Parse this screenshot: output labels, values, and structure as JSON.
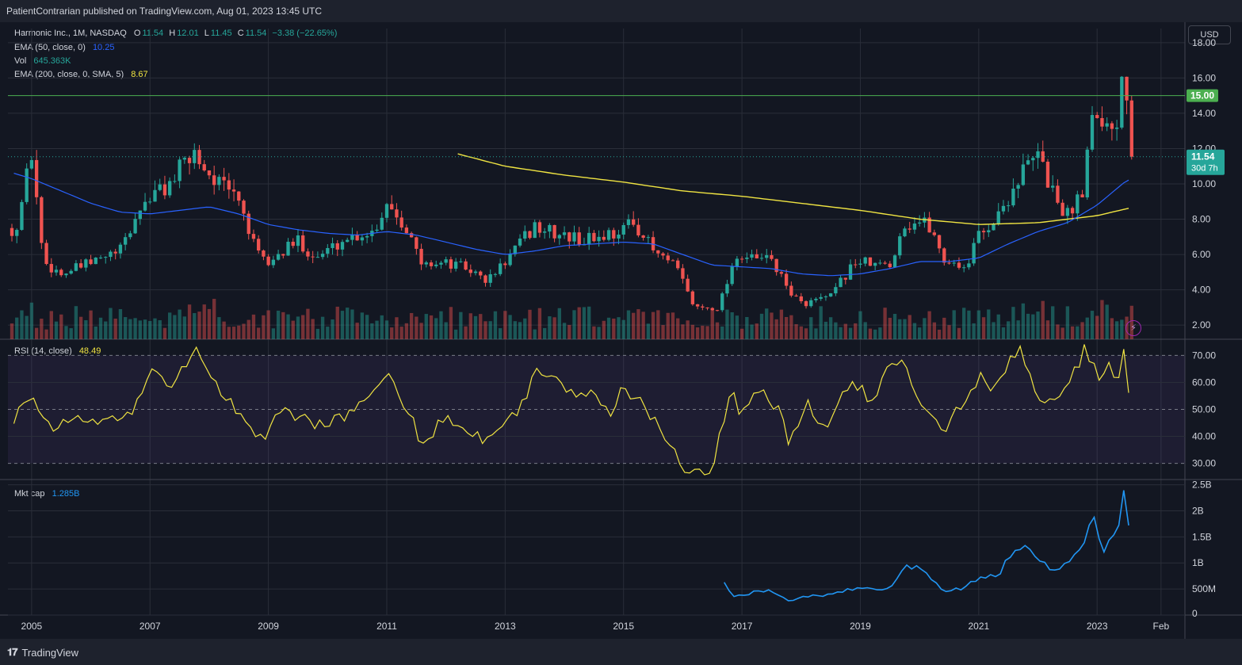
{
  "header": {
    "publisher": "PatientContrarian published on TradingView.com, Aug 01, 2023 13:45 UTC"
  },
  "footer": {
    "brand": "TradingView"
  },
  "currency_button": "USD",
  "legends": {
    "symbol": "Harmonic Inc., 1M, NASDAQ",
    "o_label": "O",
    "o_value": "11.54",
    "h_label": "H",
    "h_value": "12.01",
    "l_label": "L",
    "l_value": "11.45",
    "c_label": "C",
    "c_value": "11.54",
    "change": "−3.38 (−22.65%)",
    "ema50_label": "EMA (50, close, 0)",
    "ema50_value": "10.25",
    "vol_label": "Vol",
    "vol_value": "645.363K",
    "ema200_label": "EMA (200, close, 0, SMA, 5)",
    "ema200_value": "8.67",
    "rsi_label": "RSI (14, close)",
    "rsi_value": "48.49",
    "mktcap_label": "Mkt cap",
    "mktcap_value": "1.285B"
  },
  "price_tags": {
    "level": "15.00",
    "last": "11.54",
    "countdown": "30d 7h"
  },
  "colors": {
    "up": "#26a69a",
    "down": "#ef5350",
    "ema50": "#2962ff",
    "ema200": "#f0e442",
    "rsi": "#f0e442",
    "mktcap": "#2196f3",
    "level": "#4caf50",
    "background": "#131722"
  },
  "chart_data": {
    "type": "candlestick",
    "interval": "1M",
    "symbol": "Harmonic Inc., NASDAQ",
    "x_ticks": [
      "2005",
      "2007",
      "2009",
      "2011",
      "2013",
      "2015",
      "2017",
      "2019",
      "2021",
      "2023",
      "Feb"
    ],
    "price_axis": {
      "ticks": [
        "18.00",
        "16.00",
        "14.00",
        "12.00",
        "10.00",
        "8.00",
        "6.00",
        "4.00",
        "2.00"
      ],
      "range": [
        1.2,
        18.8
      ]
    },
    "horizontal_level": 15.0,
    "last_price": 11.54,
    "close_anchors": [
      [
        2004.75,
        7.5
      ],
      [
        2005.0,
        11.8
      ],
      [
        2005.2,
        5.6
      ],
      [
        2005.5,
        4.9
      ],
      [
        2006.0,
        5.5
      ],
      [
        2006.5,
        6.2
      ],
      [
        2006.9,
        9.0
      ],
      [
        2007.3,
        9.9
      ],
      [
        2007.75,
        11.8
      ],
      [
        2008.0,
        10.6
      ],
      [
        2008.3,
        9.6
      ],
      [
        2008.5,
        9.2
      ],
      [
        2008.8,
        6.0
      ],
      [
        2009.0,
        5.5
      ],
      [
        2009.5,
        6.8
      ],
      [
        2009.8,
        5.8
      ],
      [
        2010.3,
        6.9
      ],
      [
        2010.8,
        7.4
      ],
      [
        2011.0,
        9.0
      ],
      [
        2011.3,
        7.8
      ],
      [
        2011.6,
        5.3
      ],
      [
        2011.8,
        5.6
      ],
      [
        2012.3,
        5.3
      ],
      [
        2012.7,
        4.5
      ],
      [
        2013.0,
        5.6
      ],
      [
        2013.5,
        7.6
      ],
      [
        2013.8,
        7.2
      ],
      [
        2014.3,
        6.8
      ],
      [
        2014.8,
        7.2
      ],
      [
        2015.2,
        7.8
      ],
      [
        2015.5,
        6.2
      ],
      [
        2015.9,
        5.2
      ],
      [
        2016.2,
        3.0
      ],
      [
        2016.6,
        3.0
      ],
      [
        2016.9,
        6.0
      ],
      [
        2017.2,
        5.7
      ],
      [
        2017.5,
        5.8
      ],
      [
        2017.7,
        4.4
      ],
      [
        2018.0,
        3.2
      ],
      [
        2018.5,
        3.6
      ],
      [
        2018.9,
        5.6
      ],
      [
        2019.5,
        5.3
      ],
      [
        2019.7,
        7.6
      ],
      [
        2020.0,
        7.9
      ],
      [
        2020.2,
        7.5
      ],
      [
        2020.4,
        5.7
      ],
      [
        2020.8,
        5.3
      ],
      [
        2021.0,
        7.2
      ],
      [
        2021.3,
        8.0
      ],
      [
        2021.7,
        10.5
      ],
      [
        2022.0,
        11.6
      ],
      [
        2022.3,
        9.2
      ],
      [
        2022.5,
        8.2
      ],
      [
        2022.75,
        9.8
      ],
      [
        2022.9,
        13.8
      ],
      [
        2023.0,
        14.5
      ],
      [
        2023.2,
        12.9
      ],
      [
        2023.35,
        14.0
      ],
      [
        2023.45,
        17.5
      ],
      [
        2023.58,
        11.54
      ]
    ],
    "ema50_anchors": [
      [
        2004.7,
        10.6
      ],
      [
        2005.0,
        10.3
      ],
      [
        2005.5,
        9.6
      ],
      [
        2006.0,
        8.9
      ],
      [
        2006.5,
        8.4
      ],
      [
        2007.0,
        8.3
      ],
      [
        2007.5,
        8.5
      ],
      [
        2008.0,
        8.7
      ],
      [
        2008.5,
        8.3
      ],
      [
        2009.0,
        7.7
      ],
      [
        2009.5,
        7.4
      ],
      [
        2010.0,
        7.2
      ],
      [
        2010.5,
        7.1
      ],
      [
        2011.0,
        7.3
      ],
      [
        2011.5,
        7.1
      ],
      [
        2012.0,
        6.7
      ],
      [
        2012.5,
        6.3
      ],
      [
        2013.0,
        6.0
      ],
      [
        2013.5,
        6.2
      ],
      [
        2014.0,
        6.5
      ],
      [
        2014.5,
        6.6
      ],
      [
        2015.0,
        6.7
      ],
      [
        2015.5,
        6.6
      ],
      [
        2016.0,
        6.0
      ],
      [
        2016.5,
        5.4
      ],
      [
        2017.0,
        5.3
      ],
      [
        2017.5,
        5.2
      ],
      [
        2018.0,
        4.9
      ],
      [
        2018.5,
        4.8
      ],
      [
        2019.0,
        4.9
      ],
      [
        2019.5,
        5.2
      ],
      [
        2020.0,
        5.6
      ],
      [
        2020.5,
        5.6
      ],
      [
        2021.0,
        5.8
      ],
      [
        2021.5,
        6.6
      ],
      [
        2022.0,
        7.3
      ],
      [
        2022.5,
        7.8
      ],
      [
        2023.0,
        8.8
      ],
      [
        2023.5,
        10.2
      ],
      [
        2023.6,
        10.25
      ]
    ],
    "ema200_anchors": [
      [
        2012.2,
        11.7
      ],
      [
        2013.0,
        11.0
      ],
      [
        2014.0,
        10.5
      ],
      [
        2015.0,
        10.1
      ],
      [
        2016.0,
        9.6
      ],
      [
        2017.0,
        9.3
      ],
      [
        2018.0,
        8.9
      ],
      [
        2019.0,
        8.5
      ],
      [
        2020.0,
        8.0
      ],
      [
        2021.0,
        7.7
      ],
      [
        2022.0,
        7.8
      ],
      [
        2023.0,
        8.2
      ],
      [
        2023.6,
        8.67
      ]
    ],
    "rsi": {
      "axis_ticks": [
        "70.00",
        "60.00",
        "50.00",
        "40.00",
        "30.00"
      ],
      "range": [
        24,
        76
      ],
      "band": [
        30,
        70
      ],
      "anchors": [
        [
          2004.7,
          47
        ],
        [
          2005.0,
          57
        ],
        [
          2005.3,
          44
        ],
        [
          2006.0,
          46
        ],
        [
          2006.7,
          48
        ],
        [
          2007.0,
          66
        ],
        [
          2007.3,
          57
        ],
        [
          2007.75,
          73
        ],
        [
          2008.1,
          60
        ],
        [
          2008.6,
          47
        ],
        [
          2008.85,
          38
        ],
        [
          2009.2,
          50
        ],
        [
          2009.8,
          44
        ],
        [
          2010.5,
          50
        ],
        [
          2011.0,
          62
        ],
        [
          2011.3,
          52
        ],
        [
          2011.6,
          37
        ],
        [
          2012.0,
          48
        ],
        [
          2012.6,
          39
        ],
        [
          2013.0,
          46
        ],
        [
          2013.3,
          52
        ],
        [
          2013.5,
          66
        ],
        [
          2013.8,
          63
        ],
        [
          2014.0,
          56
        ],
        [
          2014.5,
          56
        ],
        [
          2014.8,
          46
        ],
        [
          2015.0,
          59
        ],
        [
          2015.3,
          52
        ],
        [
          2015.7,
          40
        ],
        [
          2016.0,
          29
        ],
        [
          2016.5,
          28
        ],
        [
          2016.8,
          57
        ],
        [
          2017.0,
          48
        ],
        [
          2017.3,
          59
        ],
        [
          2017.6,
          50
        ],
        [
          2017.8,
          38
        ],
        [
          2018.1,
          52
        ],
        [
          2018.4,
          43
        ],
        [
          2018.8,
          58
        ],
        [
          2019.0,
          59
        ],
        [
          2019.2,
          51
        ],
        [
          2019.5,
          68
        ],
        [
          2019.75,
          69
        ],
        [
          2020.0,
          53
        ],
        [
          2020.45,
          43
        ],
        [
          2020.7,
          52
        ],
        [
          2021.0,
          62
        ],
        [
          2021.3,
          57
        ],
        [
          2021.5,
          66
        ],
        [
          2021.7,
          74
        ],
        [
          2022.0,
          55
        ],
        [
          2022.3,
          51
        ],
        [
          2022.5,
          57
        ],
        [
          2022.8,
          73
        ],
        [
          2023.0,
          62
        ],
        [
          2023.2,
          66
        ],
        [
          2023.35,
          61
        ],
        [
          2023.45,
          71
        ],
        [
          2023.58,
          48.49
        ]
      ]
    },
    "mktcap": {
      "axis_ticks": [
        "2.5B",
        "2B",
        "1.5B",
        "1B",
        "500M",
        "0"
      ],
      "range": [
        0,
        2.6
      ],
      "anchors": [
        [
          2016.7,
          0.6
        ],
        [
          2016.85,
          0.35
        ],
        [
          2017.0,
          0.4
        ],
        [
          2017.3,
          0.45
        ],
        [
          2017.5,
          0.45
        ],
        [
          2017.8,
          0.25
        ],
        [
          2018.0,
          0.35
        ],
        [
          2018.5,
          0.4
        ],
        [
          2018.9,
          0.5
        ],
        [
          2019.5,
          0.5
        ],
        [
          2019.75,
          0.9
        ],
        [
          2020.0,
          0.95
        ],
        [
          2020.25,
          0.6
        ],
        [
          2020.45,
          0.45
        ],
        [
          2020.7,
          0.5
        ],
        [
          2021.0,
          0.7
        ],
        [
          2021.3,
          0.75
        ],
        [
          2021.5,
          1.05
        ],
        [
          2021.75,
          1.3
        ],
        [
          2022.0,
          1.05
        ],
        [
          2022.3,
          0.85
        ],
        [
          2022.5,
          1.05
        ],
        [
          2022.8,
          1.4
        ],
        [
          2022.95,
          1.9
        ],
        [
          2023.1,
          1.25
        ],
        [
          2023.25,
          1.7
        ],
        [
          2023.35,
          1.5
        ],
        [
          2023.45,
          2.45
        ],
        [
          2023.58,
          1.285
        ]
      ]
    }
  }
}
